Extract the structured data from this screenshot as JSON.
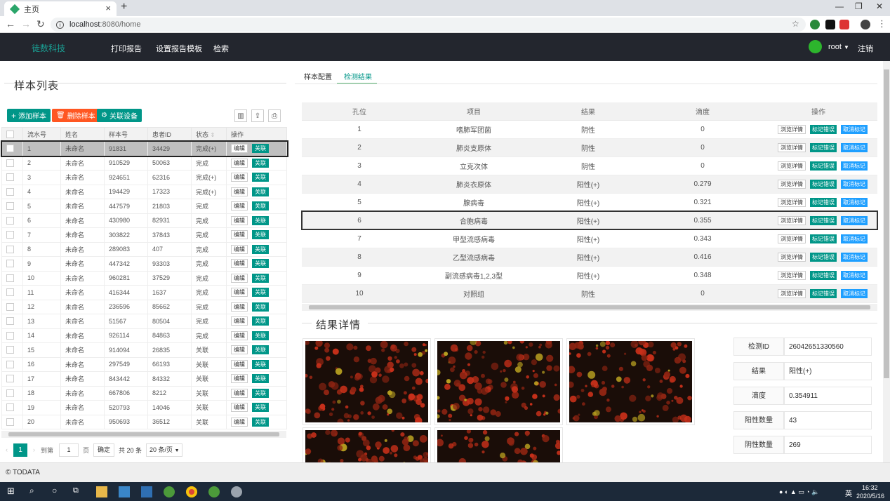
{
  "browser": {
    "tab_title": "主页",
    "url_host": "localhost",
    "url_path": ":8080/home",
    "colors": {
      "tabbar": "#dee1e6"
    }
  },
  "topbar": {
    "brand": "徒数科技",
    "menu": [
      "打印报告",
      "设置报告模板",
      "检索"
    ],
    "user": "root",
    "logout": "注销"
  },
  "left": {
    "title": "样本列表",
    "buttons": {
      "add": "添加样本",
      "delete": "删除样本",
      "link": "关联设备"
    },
    "columns": [
      "",
      "流水号",
      "姓名",
      "样本号",
      "患者ID",
      "状态",
      "操作"
    ],
    "edit_label": "编辑",
    "link_label": "关联",
    "rows": [
      {
        "no": "1",
        "name": "未命名",
        "sample": "91831",
        "pid": "34429",
        "status": "完成(+)",
        "cls": "st-or"
      },
      {
        "no": "2",
        "name": "未命名",
        "sample": "910529",
        "pid": "50063",
        "status": "完成",
        "cls": "st-yl"
      },
      {
        "no": "3",
        "name": "未命名",
        "sample": "924651",
        "pid": "62316",
        "status": "完成(+)",
        "cls": "st-or"
      },
      {
        "no": "4",
        "name": "未命名",
        "sample": "194429",
        "pid": "17323",
        "status": "完成(+)",
        "cls": "st-or"
      },
      {
        "no": "5",
        "name": "未命名",
        "sample": "447579",
        "pid": "21803",
        "status": "完成",
        "cls": "st-yl"
      },
      {
        "no": "6",
        "name": "未命名",
        "sample": "430980",
        "pid": "82931",
        "status": "完成",
        "cls": "st-yl"
      },
      {
        "no": "7",
        "name": "未命名",
        "sample": "303822",
        "pid": "37843",
        "status": "完成",
        "cls": "st-yl"
      },
      {
        "no": "8",
        "name": "未命名",
        "sample": "289083",
        "pid": "407",
        "status": "完成",
        "cls": "st-yl"
      },
      {
        "no": "9",
        "name": "未命名",
        "sample": "447342",
        "pid": "93303",
        "status": "完成",
        "cls": "st-yl"
      },
      {
        "no": "10",
        "name": "未命名",
        "sample": "960281",
        "pid": "37529",
        "status": "完成",
        "cls": "st-yl"
      },
      {
        "no": "11",
        "name": "未命名",
        "sample": "416344",
        "pid": "1637",
        "status": "完成",
        "cls": "st-yl"
      },
      {
        "no": "12",
        "name": "未命名",
        "sample": "236596",
        "pid": "85662",
        "status": "完成",
        "cls": "st-yl"
      },
      {
        "no": "13",
        "name": "未命名",
        "sample": "51567",
        "pid": "80504",
        "status": "完成",
        "cls": "st-yl"
      },
      {
        "no": "14",
        "name": "未命名",
        "sample": "926114",
        "pid": "84863",
        "status": "完成",
        "cls": "st-yl"
      },
      {
        "no": "15",
        "name": "未命名",
        "sample": "914094",
        "pid": "26835",
        "status": "关联",
        "cls": "st-gr"
      },
      {
        "no": "16",
        "name": "未命名",
        "sample": "297549",
        "pid": "66193",
        "status": "关联",
        "cls": "st-gr"
      },
      {
        "no": "17",
        "name": "未命名",
        "sample": "843442",
        "pid": "84332",
        "status": "关联",
        "cls": "st-gr"
      },
      {
        "no": "18",
        "name": "未命名",
        "sample": "667806",
        "pid": "8212",
        "status": "关联",
        "cls": "st-gr"
      },
      {
        "no": "19",
        "name": "未命名",
        "sample": "520793",
        "pid": "14046",
        "status": "关联",
        "cls": "st-gr"
      },
      {
        "no": "20",
        "name": "未命名",
        "sample": "950693",
        "pid": "36512",
        "status": "关联",
        "cls": "st-gr"
      }
    ],
    "pager": {
      "current": "1",
      "goto_label": "到第",
      "page_input": "1",
      "page_unit": "页",
      "confirm": "确定",
      "total": "共 20 条",
      "page_size": "20 条/页"
    }
  },
  "right": {
    "tabs": [
      "样本配置",
      "检测结果"
    ],
    "columns": [
      "孔位",
      "项目",
      "结果",
      "滴度",
      "操作"
    ],
    "view_label": "浏览详情",
    "mark_label": "标记错误",
    "cancel_label": "取消标记",
    "rows": [
      {
        "pos": "1",
        "item": "嗜肺军团菌",
        "result": "阴性",
        "cls": "neg",
        "titer": "0"
      },
      {
        "pos": "2",
        "item": "肺炎支原体",
        "result": "阴性",
        "cls": "neg",
        "titer": "0"
      },
      {
        "pos": "3",
        "item": "立克次体",
        "result": "阴性",
        "cls": "neg",
        "titer": "0"
      },
      {
        "pos": "4",
        "item": "肺炎衣原体",
        "result": "阳性(+)",
        "cls": "pos",
        "titer": "0.279"
      },
      {
        "pos": "5",
        "item": "腺病毒",
        "result": "阳性(+)",
        "cls": "pos",
        "titer": "0.321"
      },
      {
        "pos": "6",
        "item": "合胞病毒",
        "result": "阳性(+)",
        "cls": "pos",
        "titer": "0.355"
      },
      {
        "pos": "7",
        "item": "甲型流感病毒",
        "result": "阳性(+)",
        "cls": "pos",
        "titer": "0.343"
      },
      {
        "pos": "8",
        "item": "乙型流感病毒",
        "result": "阳性(+)",
        "cls": "pos",
        "titer": "0.416"
      },
      {
        "pos": "9",
        "item": "副流感病毒1,2,3型",
        "result": "阳性(+)",
        "cls": "pos",
        "titer": "0.348"
      },
      {
        "pos": "10",
        "item": "对照组",
        "result": "阴性",
        "cls": "neg",
        "titer": "0"
      }
    ],
    "detail_title": "结果详情",
    "info": [
      {
        "label": "检测ID",
        "value": "26042651330560"
      },
      {
        "label": "结果",
        "value": "阳性(+)"
      },
      {
        "label": "滴度",
        "value": "0.354911"
      },
      {
        "label": "阳性数量",
        "value": "43"
      },
      {
        "label": "阴性数量",
        "value": "269"
      }
    ]
  },
  "footer": "© TODATA",
  "taskbar": {
    "time": "16:32",
    "date": "2020/5/16",
    "ime": "英"
  }
}
